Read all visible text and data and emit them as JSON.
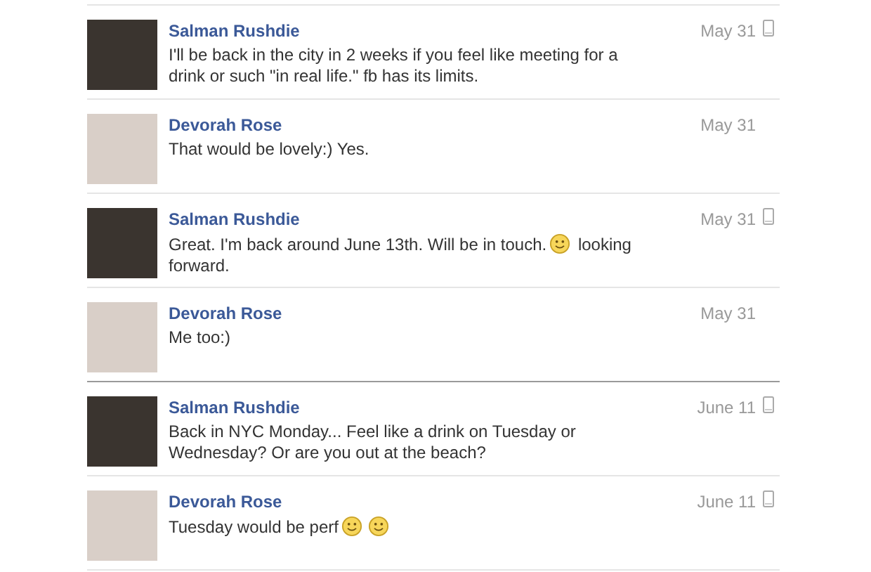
{
  "messages": [
    {
      "sender": "Salman Rushdie",
      "date": "May 31",
      "mobile": true,
      "section_break": false,
      "parts": [
        {
          "kind": "text",
          "text": "I'll be back in the city in 2 weeks if you feel like meeting for a drink or such \"in real life.\" fb has its limits."
        }
      ]
    },
    {
      "sender": "Devorah Rose",
      "date": "May 31",
      "mobile": false,
      "section_break": false,
      "parts": [
        {
          "kind": "text",
          "text": "That would be lovely:) Yes."
        }
      ]
    },
    {
      "sender": "Salman Rushdie",
      "date": "May 31",
      "mobile": true,
      "section_break": false,
      "parts": [
        {
          "kind": "text",
          "text": "Great. I'm back around June 13th. Will be in touch."
        },
        {
          "kind": "smiley"
        },
        {
          "kind": "text",
          "text": "looking forward."
        }
      ]
    },
    {
      "sender": "Devorah Rose",
      "date": "May 31",
      "mobile": false,
      "section_break": false,
      "parts": [
        {
          "kind": "text",
          "text": "Me too:)"
        }
      ]
    },
    {
      "sender": "Salman Rushdie",
      "date": "June 11",
      "mobile": true,
      "section_break": true,
      "parts": [
        {
          "kind": "text",
          "text": "Back in NYC Monday... Feel like a drink on Tuesday or Wednesday? Or are you out at the beach?"
        }
      ]
    },
    {
      "sender": "Devorah Rose",
      "date": "June 11",
      "mobile": true,
      "section_break": false,
      "parts": [
        {
          "kind": "text",
          "text": "Tuesday would be perf"
        },
        {
          "kind": "smiley"
        },
        {
          "kind": "smiley"
        }
      ]
    }
  ]
}
